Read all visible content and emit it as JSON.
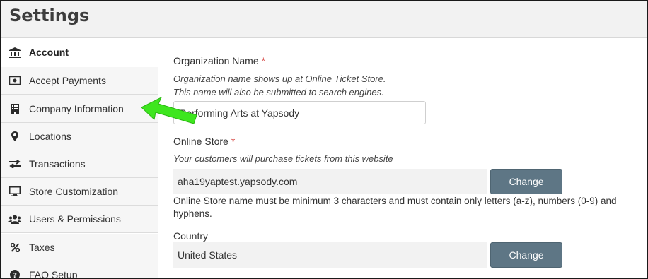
{
  "header": {
    "title": "Settings"
  },
  "sidebar": {
    "items": [
      {
        "label": "Account",
        "icon": "bank-icon",
        "active": true
      },
      {
        "label": "Accept Payments",
        "icon": "money-icon"
      },
      {
        "label": "Company Information",
        "icon": "building-icon"
      },
      {
        "label": "Locations",
        "icon": "map-marker-icon"
      },
      {
        "label": "Transactions",
        "icon": "exchange-icon"
      },
      {
        "label": "Store Customization",
        "icon": "desktop-icon"
      },
      {
        "label": "Users & Permissions",
        "icon": "users-icon"
      },
      {
        "label": "Taxes",
        "icon": "percent-icon"
      },
      {
        "label": "FAQ Setup",
        "icon": "question-circle-icon"
      }
    ]
  },
  "form": {
    "org": {
      "label": "Organization Name",
      "required_mark": "*",
      "help_line1": "Organization name shows up at Online Ticket Store.",
      "help_line2": "This name will also be submitted to search engines.",
      "value": "Performing Arts at Yapsody"
    },
    "store": {
      "label": "Online Store",
      "required_mark": "*",
      "help": "Your customers will purchase tickets from this website",
      "value": "aha19yaptest.yapsody.com",
      "button": "Change",
      "note": "Online Store name must be minimum 3 characters and must contain only letters (a-z), numbers (0-9) and hyphens."
    },
    "country": {
      "label": "Country",
      "value": "United States",
      "button": "Change"
    }
  },
  "colors": {
    "arrow": "#3ee61f",
    "button": "#5e7685",
    "required": "#d9534f"
  }
}
